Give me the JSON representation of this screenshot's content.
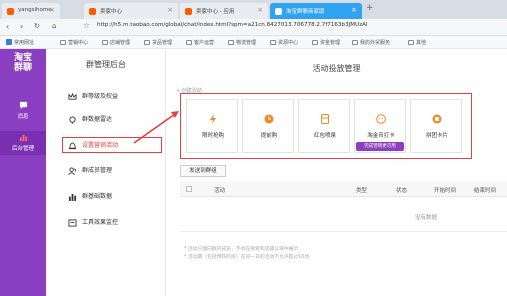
{
  "browser": {
    "tabs": [
      {
        "label": "yangsihome"
      },
      {
        "label": "卖家中心"
      },
      {
        "label": "卖家中心 - 应用"
      },
      {
        "label": "淘宝群聊商家版"
      }
    ],
    "new_tab": "+",
    "url": "http://h5.m.taobao.com/global/chat/index.html?spm=a21cn.8427013.706778.2.7f7163b3JMUzAl",
    "bookmarks": [
      "常用网址",
      "营销中心",
      "店铺管理",
      "货品管理",
      "客户运营",
      "物流管理",
      "资源中心",
      "资金管理",
      "我的外贸服务",
      "其他"
    ]
  },
  "sidebar": {
    "logo": "淘宝\n群聊",
    "items": [
      {
        "label": "消息",
        "icon": "chat-bubble-icon"
      },
      {
        "label": "后台管理",
        "icon": "bar-chart-icon"
      }
    ]
  },
  "menu": {
    "title": "群管理后台",
    "items": [
      {
        "label": "群等级及权益",
        "icon": "crown-icon"
      },
      {
        "label": "群数据雷达",
        "icon": "bulb-icon"
      },
      {
        "label": "设置营销活动",
        "icon": "bell-icon"
      },
      {
        "label": "群成员管理",
        "icon": "users-icon"
      },
      {
        "label": "群基础数据",
        "icon": "bar-chart-icon"
      },
      {
        "label": "工具效果监控",
        "icon": "monitor-icon"
      }
    ]
  },
  "main": {
    "title": "活动投放管理",
    "create_label": "+ 创建活动",
    "activities": [
      {
        "label": "限时抢购",
        "icon": "lightning-icon"
      },
      {
        "label": "提前购",
        "icon": "clock-icon"
      },
      {
        "label": "红包喷泉",
        "icon": "red-packet-icon"
      },
      {
        "label": "淘金币打卡",
        "icon": "coin-icon"
      },
      {
        "label": "拼团卡片",
        "icon": "group-card-icon"
      }
    ],
    "recommend_badge": "完成营销更可用",
    "send_button": "发送到群组",
    "columns": [
      "活动",
      "类型",
      "状态",
      "开始时间",
      "结束时间"
    ],
    "empty_text": "没有数据",
    "notes": [
      "* 活动只面向群内成员，不会在搜索和店铺公域中展示",
      "* 活动期（包括预热阶段）在同一日的活动不允许超过10场"
    ]
  },
  "colors": {
    "sidebar_purple": "#8a3fc1",
    "highlight_red": "#e1413f",
    "active_tab_blue": "#2fa3f1",
    "icon_orange": "#f08a24"
  }
}
